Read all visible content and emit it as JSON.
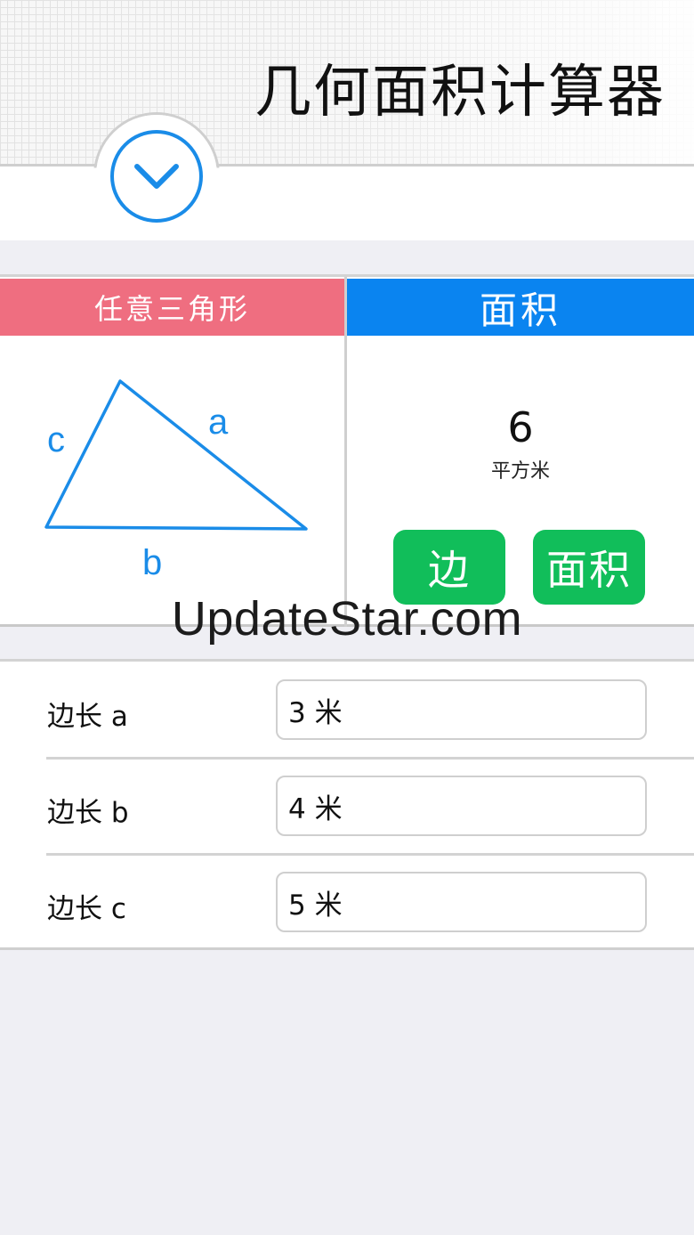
{
  "header": {
    "title": "几何面积计算器",
    "toggle_icon": "chevron-down-icon"
  },
  "shape_panel": {
    "tab_label": "任意三角形",
    "side_labels": {
      "a": "a",
      "b": "b",
      "c": "c"
    }
  },
  "result_panel": {
    "tab_label": "面积",
    "value": "6",
    "unit": "平方米",
    "buttons": {
      "side": "边",
      "area": "面积"
    }
  },
  "watermark": "UpdateStar.com",
  "inputs": [
    {
      "label": "边长 a",
      "value": "3 米"
    },
    {
      "label": "边长 b",
      "value": "4 米"
    },
    {
      "label": "边长 c",
      "value": "5 米"
    }
  ],
  "colors": {
    "shape_tab": "#ef6e80",
    "result_tab": "#0a84f0",
    "action_button": "#11be5a",
    "diagram": "#1a8ce8"
  }
}
